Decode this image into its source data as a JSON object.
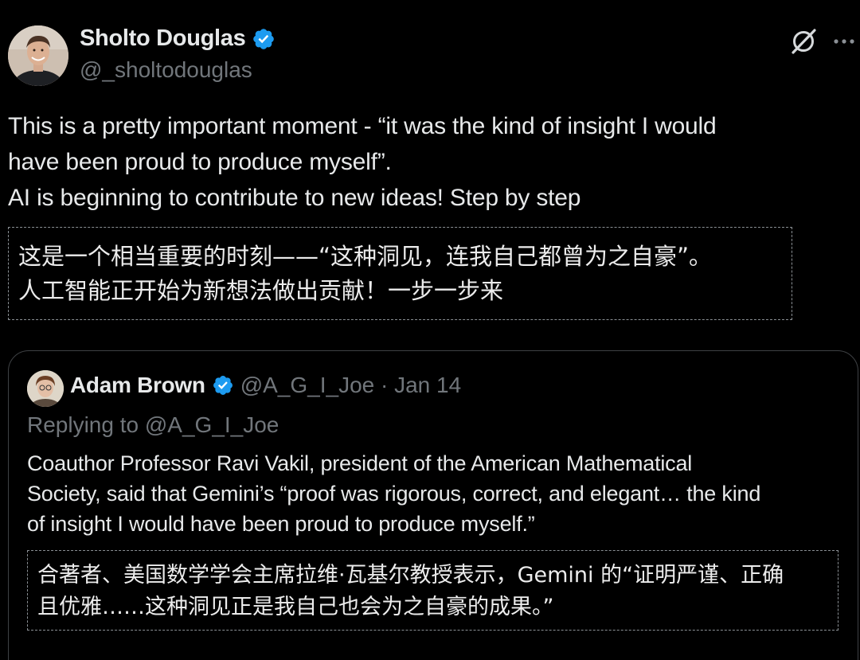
{
  "post": {
    "author": {
      "name": "Sholto Douglas",
      "handle": "@_sholtodouglas",
      "verified": true
    },
    "text_lines": [
      "This is a pretty important moment - “it was the kind of insight I would",
      "have been proud to produce myself”.",
      "AI is beginning to contribute to new ideas! Step by step"
    ],
    "translation_lines": [
      "这是一个相当重要的时刻——“这种洞见，连我自己都曾为之自豪”。",
      "人工智能正开始为新想法做出贡献！一步一步来"
    ],
    "actions": [
      "grok-icon",
      "more-icon"
    ]
  },
  "quote": {
    "author": {
      "name": "Adam Brown",
      "handle": "@A_G_I_Joe",
      "verified": true
    },
    "meta": "@A_G_I_Joe · Jan 14",
    "replying_to": "Replying to @A_G_I_Joe",
    "text_lines": [
      "Coauthor Professor Ravi Vakil, president of the American Mathematical",
      "Society, said that Gemini’s “proof was rigorous, correct, and elegant… the kind",
      "of insight I would have been proud to produce myself.”"
    ],
    "translation_lines": [
      "合著者、美国数学学会主席拉维·瓦基尔教授表示，Gemini 的“证明严谨、正确",
      "且优雅……这种洞见正是我自己也会为之自豪的成果。”"
    ]
  },
  "colors": {
    "background": "#000000",
    "text_primary": "#e7e9ea",
    "text_secondary": "#71767b",
    "verified_badge": "#1d9bf0",
    "card_border": "#3e4144",
    "dashed_border": "#8a8f94"
  }
}
